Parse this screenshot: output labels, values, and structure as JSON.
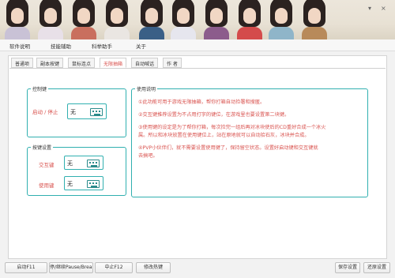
{
  "window": {
    "minimize_label": "▾",
    "close_label": "×"
  },
  "menu": [
    {
      "label": "软件说明"
    },
    {
      "label": "技能辅助"
    },
    {
      "label": "科举助手"
    },
    {
      "label": "关于"
    }
  ],
  "tabs": [
    {
      "label": "普通项"
    },
    {
      "label": "副本按键"
    },
    {
      "label": "鼠标连点"
    },
    {
      "label": "无限抽箱"
    },
    {
      "label": "自动喊话"
    },
    {
      "label": "作 者"
    }
  ],
  "control_group": {
    "title": "控制键",
    "start_stop_label": "启动 / 停止",
    "start_stop_value": "无"
  },
  "key_group": {
    "title": "按键设置",
    "interact_label": "交互键",
    "interact_value": "无",
    "use_label": "使用键",
    "use_value": "无"
  },
  "instructions": {
    "title": "使用说明",
    "lines": [
      "①此功能可用于游戏无限抽箱，帮你打箱自动捡署和搜匿。",
      "②交互键推荐设置为不占用打字的键位，在游戏里也要设置第二块键。",
      "③使用键的设定是为了帮你打箱，每次捡完一组后再对冰块使后的CD重好合成一个冰火",
      "属。所以和冰块放置在使用键位上，站在原地就可以自动拾石灰，冰块并合成。",
      "④PVP小伙伴们，就不需要设置使用键了，保持留空状态。设置好启动键和交互键就",
      "去搞吧。"
    ]
  },
  "buttons": {
    "start": "启动F11",
    "pause": "停/继续Pause/Break",
    "stop": "中止F12",
    "modify": "修改热键",
    "save": "保存设置",
    "restore": "还原设置"
  },
  "colors": {
    "accent": "#31b0b0",
    "highlight_text": "#d9534f"
  }
}
